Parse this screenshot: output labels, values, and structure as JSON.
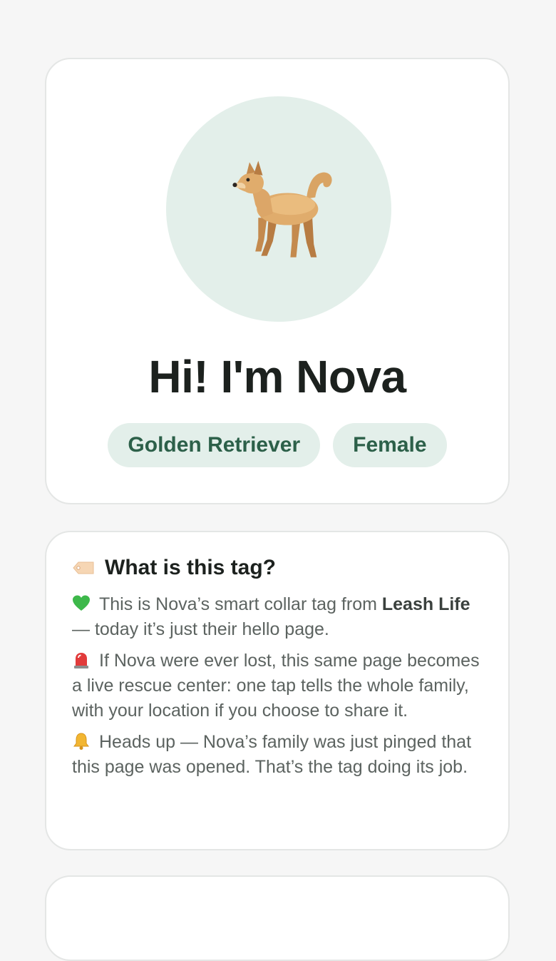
{
  "profile": {
    "avatar_icon": "dog-icon",
    "title": "Hi! I'm Nova",
    "chips": [
      "Golden Retriever",
      "Female"
    ]
  },
  "info": {
    "heading_icon": "tag-icon",
    "heading": "What is this tag?",
    "items": [
      {
        "icon": "green-heart-icon",
        "before": "This is Nova’s smart collar tag from ",
        "bold": "Leash Life",
        "after": " — today it’s just their hello page."
      },
      {
        "icon": "siren-icon",
        "text": "If Nova were ever lost, this same page becomes a live rescue center: one tap tells the whole family, with your location if you choose to share it."
      },
      {
        "icon": "bell-icon",
        "text": "Heads up — Nova’s family was just pinged that this page was opened. That’s the tag doing its job."
      }
    ]
  },
  "colors": {
    "accent_bg": "#e3efea",
    "accent_text": "#2c6049",
    "page_bg": "#f6f6f6"
  }
}
